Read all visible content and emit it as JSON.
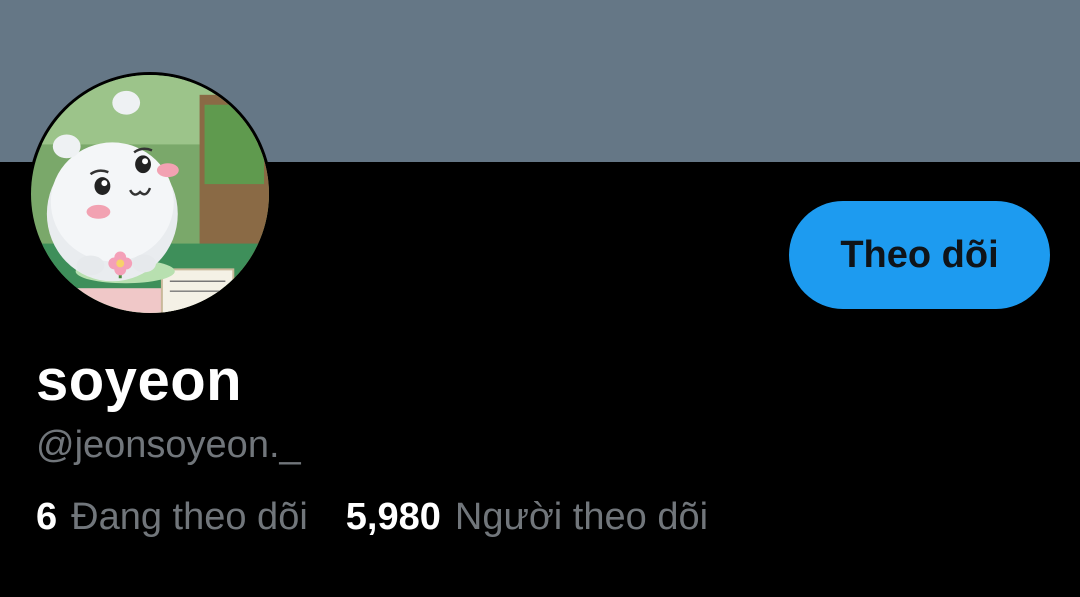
{
  "profile": {
    "display_name": "soyeon",
    "handle": "@jeonsoyeon._",
    "follow_button_label": "Theo dõi",
    "following_count": "6",
    "following_label": "Đang theo dõi",
    "followers_count": "5,980",
    "followers_label": "Người theo dõi",
    "avatar_icon": "plush-character-avatar"
  },
  "colors": {
    "banner": "#657786",
    "background": "#000000",
    "accent": "#1d9bf0",
    "secondary_text": "#71767b"
  }
}
